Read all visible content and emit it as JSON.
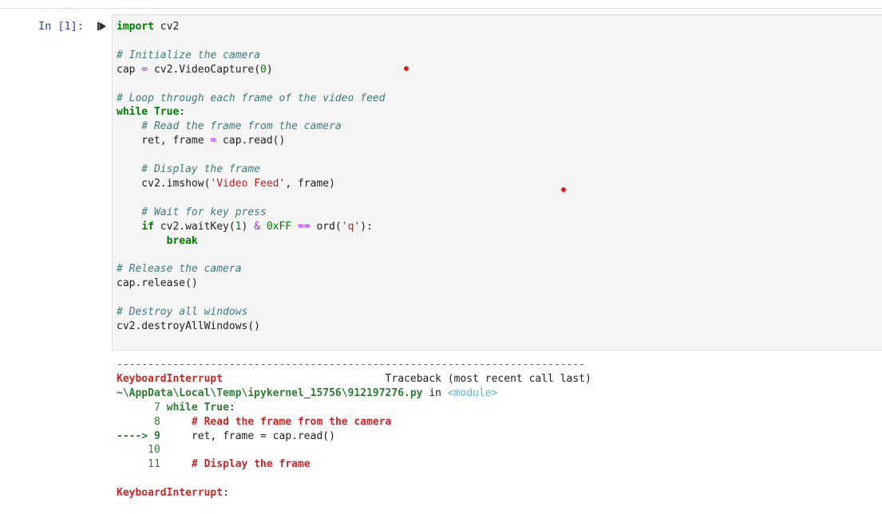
{
  "cell": {
    "prompt": "In [1]:",
    "run_icon": "run-step-icon"
  },
  "code": {
    "l01_kw": "import",
    "l01_rest": " cv2",
    "l03_cm": "# Initialize the camera",
    "l04_a": "cap ",
    "l04_op": "=",
    "l04_b": " cv2.VideoCapture(",
    "l04_num": "0",
    "l04_c": ")",
    "l06_cm": "# Loop through each frame of the video feed",
    "l07_kw": "while",
    "l07_sp": " ",
    "l07_kw2": "True",
    "l07_c": ":",
    "l08_cm": "    # Read the frame from the camera",
    "l09_a": "    ret, frame ",
    "l09_op": "=",
    "l09_b": " cap.read()",
    "l11_cm": "    # Display the frame",
    "l12_a": "    cv2.imshow(",
    "l12_str": "'Video Feed'",
    "l12_b": ", frame)",
    "l14_cm": "    # Wait for key press",
    "l15_ind": "    ",
    "l15_kw": "if",
    "l15_a": " cv2.waitKey(",
    "l15_num": "1",
    "l15_b": ") ",
    "l15_op": "&",
    "l15_sp": " ",
    "l15_num2": "0xFF",
    "l15_sp2": " ",
    "l15_op2": "==",
    "l15_c": " ord(",
    "l15_str": "'q'",
    "l15_d": "):",
    "l16_ind": "        ",
    "l16_kw": "break",
    "l18_cm": "# Release the camera",
    "l19": "cap.release()",
    "l21_cm": "# Destroy all windows",
    "l22": "cv2.destroyAllWindows()"
  },
  "traceback": {
    "dashes": "---------------------------------------------------------------------------",
    "error_name": "KeyboardInterrupt",
    "header_right": "                          Traceback (most recent call last)",
    "path": "~\\AppData\\Local\\Temp\\ipykernel_15756\\912197276.py",
    "in_text": " in ",
    "module": "<module>",
    "l7_num": "      7 ",
    "l7_kw": "while",
    "l7_sp": " ",
    "l7_kw2": "True",
    "l7_c": ":",
    "l8_num": "      8 ",
    "l8_cm": "    # Read the frame from the camera",
    "l9_arrow": "----> 9 ",
    "l9_code": "    ret, frame = cap.read()",
    "l10_num": "     10 ",
    "l11_num": "     11 ",
    "l11_cm": "    # Display the frame",
    "final_error": "KeyboardInterrupt",
    "final_colon": ":"
  },
  "colors": {
    "prompt": "#303f9f",
    "keyword": "#008000",
    "comment": "#3d7b7b",
    "error": "#c62828",
    "annotation_dot": "#e01818"
  }
}
